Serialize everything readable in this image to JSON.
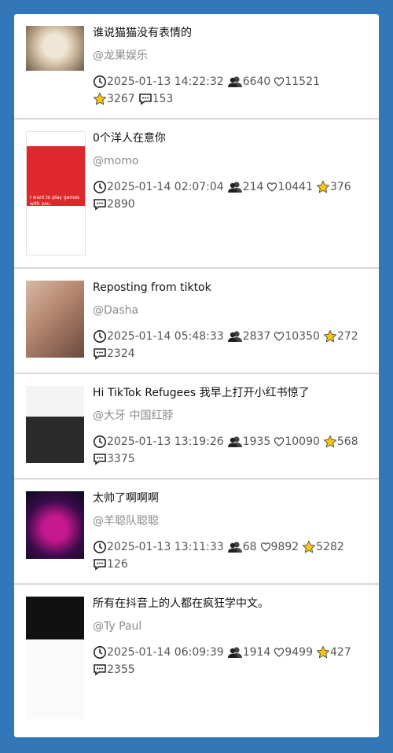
{
  "posts": [
    {
      "title": "谁说猫猫没有表情的",
      "author": "@龙果娱乐",
      "time": "2025-01-13 14:22:32",
      "users": "6640",
      "likes": "11521",
      "stars": "3267",
      "comments": "153"
    },
    {
      "title": "0个洋人在意你",
      "author": "@momo",
      "time": "2025-01-14 02:07:04",
      "users": "214",
      "likes": "10441",
      "stars": "376",
      "comments": "2890"
    },
    {
      "title": "Reposting from tiktok",
      "author": "@Dasha",
      "time": "2025-01-14 05:48:33",
      "users": "2837",
      "likes": "10350",
      "stars": "272",
      "comments": "2324"
    },
    {
      "title": "Hi TikTok Refugees 我早上打开小红书惊了",
      "author": "@大牙 中国红脖",
      "time": "2025-01-13 13:19:26",
      "users": "1935",
      "likes": "10090",
      "stars": "568",
      "comments": "3375"
    },
    {
      "title": "太帅了啊啊啊",
      "author": "@羊聪队聪聪",
      "time": "2025-01-13 13:11:33",
      "users": "68",
      "likes": "9892",
      "stars": "5282",
      "comments": "126"
    },
    {
      "title": "所有在抖音上的人都在疯狂学中文。",
      "author": "@Ty Paul",
      "time": "2025-01-14 06:09:39",
      "users": "1914",
      "likes": "9499",
      "stars": "427",
      "comments": "2355"
    }
  ],
  "thumbnail_texts": {
    "post2_banner": "I want to play games with you"
  },
  "colors": {
    "background": "#3278b9",
    "star": "#f5c518",
    "author": "#8a8a8a"
  },
  "icons": [
    "clock-icon",
    "users-icon",
    "heart-icon",
    "star-icon",
    "comment-icon"
  ]
}
